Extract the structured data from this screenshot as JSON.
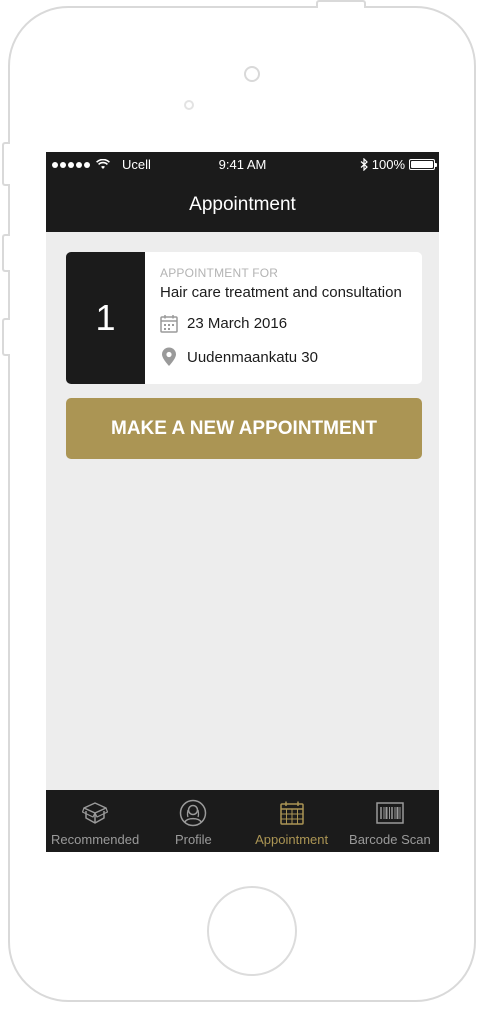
{
  "statusbar": {
    "carrier": "Ucell",
    "time": "9:41 AM",
    "battery": "100%"
  },
  "header": {
    "title": "Appointment"
  },
  "appointment": {
    "number": "1",
    "label": "APPOINTMENT FOR",
    "service": "Hair care treatment and consultation",
    "date": "23 March 2016",
    "location": "Uudenmaankatu 30"
  },
  "cta": {
    "label": "MAKE A NEW APPOINTMENT"
  },
  "tabs": [
    {
      "label": "Recommended",
      "icon": "box-icon",
      "active": false
    },
    {
      "label": "Profile",
      "icon": "person-icon",
      "active": false
    },
    {
      "label": "Appointment",
      "icon": "calendar-icon",
      "active": true
    },
    {
      "label": "Barcode Scan",
      "icon": "barcode-icon",
      "active": false
    }
  ],
  "colors": {
    "accent": "#ab9554",
    "dark": "#1b1b1b",
    "background": "#ededed",
    "inactive_tab": "#9a9a9a"
  }
}
